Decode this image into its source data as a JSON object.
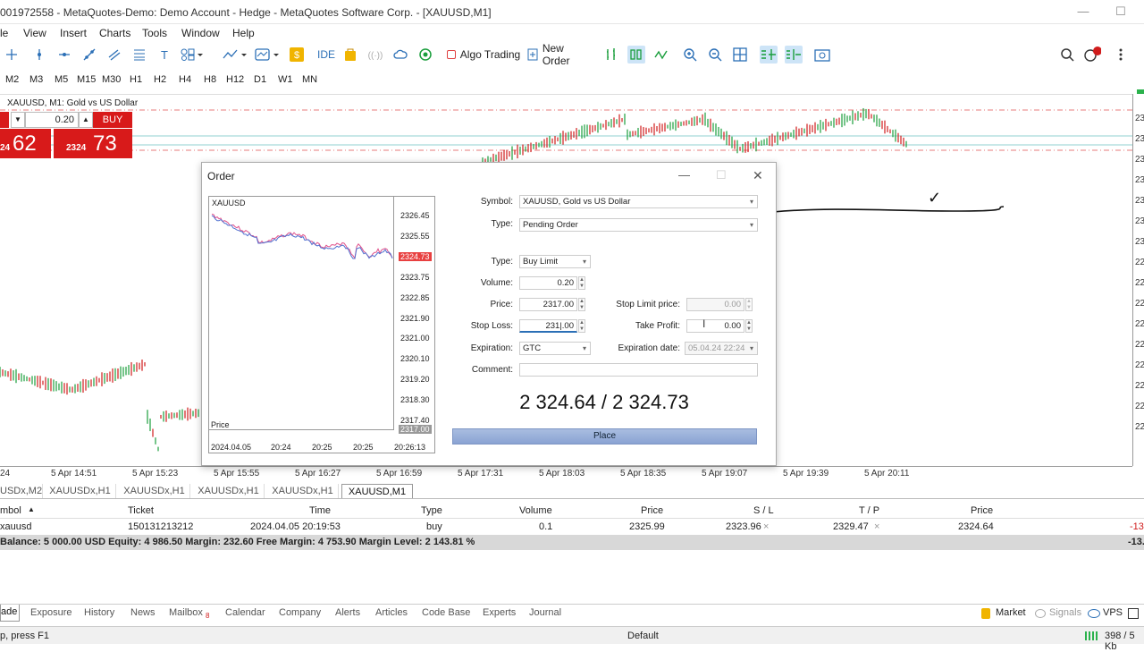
{
  "window": {
    "title": "001972558 - MetaQuotes-Demo: Demo Account - Hedge - MetaQuotes Software Corp. - [XAUUSD,M1]",
    "minimize_symbol": "—",
    "maximize_symbol": "☐"
  },
  "menu": [
    "le",
    "View",
    "Insert",
    "Charts",
    "Tools",
    "Window",
    "Help"
  ],
  "toolbar": {
    "ide_label": "IDE",
    "algo_trading_label": "Algo Trading",
    "new_order_label": "New Order",
    "notifications_count": "1"
  },
  "timeframes": [
    "M2",
    "M3",
    "M5",
    "M15",
    "M30",
    "H1",
    "H2",
    "H4",
    "H8",
    "H12",
    "D1",
    "W1",
    "MN"
  ],
  "chart": {
    "label": "XAUUSD, M1:  Gold vs US Dollar",
    "one_click": {
      "volume": "0.20",
      "buy_label": "BUY",
      "sell_price_small": "24",
      "sell_price_big": "62",
      "buy_price_small": "2324",
      "buy_price_big": "73"
    },
    "price_scale": [
      "23",
      "23",
      "23",
      "23",
      "23",
      "23",
      "23",
      "22",
      "22",
      "22",
      "22",
      "22",
      "22",
      "22",
      "22",
      "22"
    ],
    "time_axis": [
      "24",
      "5 Apr 14:51",
      "5 Apr 15:23",
      "5 Apr 15:55",
      "5 Apr 16:27",
      "5 Apr 16:59",
      "5 Apr 17:31",
      "5 Apr 18:03",
      "5 Apr 18:35",
      "5 Apr 19:07",
      "5 Apr 19:39",
      "5 Apr 20:11"
    ],
    "checkmark": "✓"
  },
  "chart_tabs": [
    "USDx,M2",
    "XAUUSDx,H1",
    "XAUUSDx,H1",
    "XAUUSDx,H1",
    "XAUUSDx,H1",
    "XAUUSD,M1"
  ],
  "order_dialog": {
    "title": "Order",
    "close_symbol": "✕",
    "mini_chart": {
      "symbol": "XAUUSD",
      "price_caption": "Price",
      "price_labels": [
        "2326.45",
        "2325.55",
        "2324.73",
        "2323.75",
        "2322.85",
        "2321.90",
        "2321.00",
        "2320.10",
        "2319.20",
        "2318.30",
        "2317.40",
        "2317.00"
      ],
      "time_labels": [
        "2024.04.05",
        "20:24",
        "20:25",
        "20:25",
        "20:26:13"
      ]
    },
    "symbol_label": "Symbol:",
    "symbol_value": "XAUUSD, Gold vs US Dollar",
    "type_label": "Type:",
    "type_value": "Pending Order",
    "order_type_label": "Type:",
    "order_type_value": "Buy Limit",
    "volume_label": "Volume:",
    "volume_value": "0.20",
    "price_label": "Price:",
    "price_value": "2317.00",
    "stop_limit_label": "Stop Limit price:",
    "stop_limit_value": "0.00",
    "stop_loss_label": "Stop Loss:",
    "stop_loss_value": "231|.00",
    "take_profit_label": "Take Profit:",
    "take_profit_value": "0.00",
    "expiration_label": "Expiration:",
    "expiration_value": "GTC",
    "expiration_date_label": "Expiration date:",
    "expiration_date_value": "05.04.24 22:24",
    "comment_label": "Comment:",
    "comment_value": "",
    "bid_ask": "2 324.64 / 2 324.73",
    "place_label": "Place"
  },
  "trade": {
    "headers": [
      "Symbol",
      "Ticket",
      "Time",
      "Type",
      "Volume",
      "Price",
      "S / L",
      "T / P",
      "Price"
    ],
    "header_symbol_visible": "mbol",
    "row": {
      "symbol": "xauusd",
      "ticket": "150131213212",
      "time": "2024.04.05 20:19:53",
      "type": "buy",
      "volume": "0.1",
      "price": "2325.99",
      "sl": "2323.96",
      "tp": "2329.47",
      "current": "2324.64",
      "profit": "-13"
    },
    "balance_text": "Balance: 5 000.00 USD  Equity: 4 986.50  Margin: 232.60  Free Margin: 4 753.90  Margin Level: 2 143.81 %",
    "balance_profit": "-13."
  },
  "bottom_tabs": [
    "ade",
    "Exposure",
    "History",
    "News",
    "Mailbox",
    "Calendar",
    "Company",
    "Alerts",
    "Articles",
    "Code Base",
    "Experts",
    "Journal"
  ],
  "mailbox_count": "8",
  "bottom_right": {
    "market_label": "Market",
    "signals_label": "Signals",
    "vps_label": "VPS"
  },
  "status": {
    "help_text": "p, press F1",
    "profile": "Default",
    "traffic": "398 / 5 Kb"
  }
}
